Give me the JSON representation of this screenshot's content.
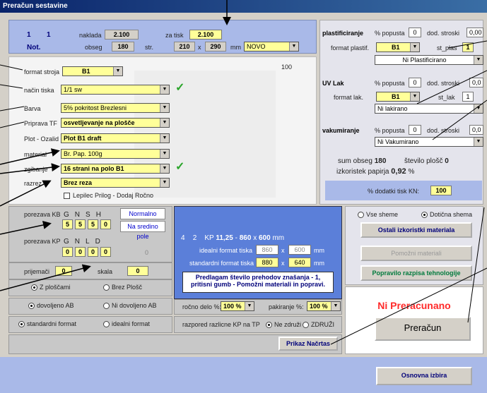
{
  "window": {
    "title": "Preračun sestavine"
  },
  "header": {
    "num1": "1",
    "num2": "1",
    "not_label": "Not.",
    "naklada_label": "naklada",
    "naklada": "2.100",
    "zatisk_label": "za tisk",
    "zatisk": "2.100",
    "obseg_label": "obseg",
    "obseg": "180",
    "str_label": "str.",
    "width": "210",
    "x": "x",
    "height": "290",
    "mm": "mm",
    "status": "NOVO"
  },
  "left": {
    "format_stroja_label": "format stroja",
    "format_stroja": "B1",
    "nacin_label": "način tiska",
    "nacin": "1/1 sw",
    "barva_label": "Barva",
    "barva": "5% pokritost Brezlesni",
    "priprava_label": "Priprava TF",
    "priprava": "osvetljevanje na plošče",
    "plot_label": "Plot - Ozalid",
    "plot": "Plot B1 draft",
    "material_label": "material",
    "material": "Br. Pap. 100g",
    "zgibanje_label": "zgibanje",
    "zgibanje": "16 strani na polo B1",
    "razrez_label": "razrez",
    "razrez": "Brez reza",
    "lepilec": "Lepilec Prilog - Dodaj Ročno",
    "num100": "100"
  },
  "right": {
    "plast_label": "plastificiranje",
    "popust_label": "% popusta",
    "popust1": "0",
    "dod_label": "dod. stroski",
    "dod1": "0,00",
    "format_plast_label": "format plastif.",
    "format_plast": "B1",
    "stplas_label": "st_plas",
    "stplas": "1",
    "ni_plast": "Ni Plastificirano",
    "uv_label": "UV Lak",
    "popust2": "0",
    "dod2": "0,0",
    "format_lak_label": "format lak.",
    "format_lak": "B1",
    "stlak_label": "st_lak",
    "stlak": "1",
    "ni_lak": "Ni lakirano",
    "vak_label": "vakumiranje",
    "popust3": "0",
    "dod3": "0,0",
    "ni_vak": "Ni Vakumirano",
    "sum_label": "sum obseg",
    "sum_val": "180",
    "stevilo_label": "število plošč",
    "stevilo_val": "0",
    "izkoristek_label": "izkoristek papirja",
    "izkoristek_val": "0,92",
    "pct": "%",
    "dodatki_label": "% dodatki tisk KN:",
    "dodatki_val": "100"
  },
  "porezava": {
    "kb_label": "porezava KB",
    "g": "G",
    "n": "N",
    "s": "S",
    "h": "H",
    "kb_vals": [
      "5",
      "5",
      "5",
      "0"
    ],
    "normalno": "Normalno",
    "na_sredino": "Na sredino pole",
    "kp_label": "porezava KP",
    "l": "L",
    "d": "D",
    "kp_vals": [
      "0",
      "0",
      "0",
      "0"
    ],
    "zero": "0",
    "prijemaci_label": "prijemači",
    "prijemaci": "0",
    "skala_label": "skala",
    "skala": "0"
  },
  "center": {
    "a": "4",
    "b": "2",
    "kp_label": "KP",
    "kp_val": "11,25",
    "dash": "-",
    "w": "860",
    "x": "x",
    "h": "600",
    "mm": "mm",
    "idealni_label": "idealni format tiska",
    "idealni_w": "860",
    "idealni_h": "600",
    "standardni_label": "standardni format tiska",
    "standardni_w": "880",
    "standardni_h": "640",
    "predlagam": "Predlagam število prehodov znašanja - 1, pritisni gumb - Pomožni materiali in popravi."
  },
  "options": {
    "z_ploscami": "Z ploščami",
    "brez_plosc": "Brez Plošč",
    "dovoljeno": "dovoljeno AB",
    "ni_dovoljeno": "Ni dovoljeno AB",
    "standardni": "standardni format",
    "idealni": "idealni format",
    "rocno_label": "ročno delo %:",
    "rocno": "100 %",
    "pakiranje_label": "pakiranje %:",
    "pakiranje": "100 %",
    "razpored_label": "razpored razlicne KP na TP",
    "ne_zdruzi": "Ne združi",
    "zdruzi": "ZDRUŽI",
    "prikaz": "Prikaz Načrtas"
  },
  "side_buttons": {
    "vse_sheme": "Vse sheme",
    "doticna": "Dotična shema",
    "ostali": "Ostali izkoristki materiala",
    "pomozni": "Pomožni materiali",
    "popravilo": "Popravilo razpisa tehnologije",
    "ni_preracunano": "Ni Preracunano",
    "preracun": "Preračun",
    "osnovna": "Osnovna izbira"
  }
}
